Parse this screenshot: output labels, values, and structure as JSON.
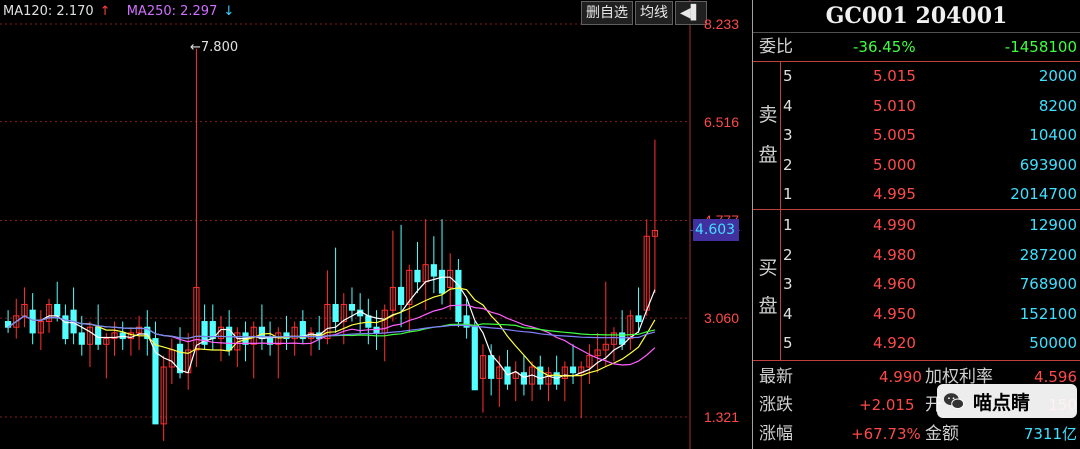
{
  "ma_legend": {
    "ma120_label": "MA120: 2.170",
    "ma120_arrow": "↑",
    "ma250_label": "MA250: 2.297",
    "ma250_arrow": "↓"
  },
  "toolbar": {
    "delete_label": "删自选",
    "avgline_label": "均线",
    "arrow_label": "◀▌"
  },
  "y_axis": [
    "8.233",
    "6.516",
    "4.777",
    "3.060",
    "1.321"
  ],
  "current_price_tag": "4.603",
  "peak_label": "7.800",
  "quote": {
    "title": "GC001 204001",
    "weibi_label": "委比",
    "weibi_pct": "-36.45%",
    "weibi_diff": "-1458100",
    "sell_label": [
      "卖",
      "盘"
    ],
    "buy_label": [
      "买",
      "盘"
    ],
    "sell": [
      {
        "level": "5",
        "price": "5.015",
        "volume": "2000"
      },
      {
        "level": "4",
        "price": "5.010",
        "volume": "8200"
      },
      {
        "level": "3",
        "price": "5.005",
        "volume": "10400"
      },
      {
        "level": "2",
        "price": "5.000",
        "volume": "693900"
      },
      {
        "level": "1",
        "price": "4.995",
        "volume": "2014700"
      }
    ],
    "buy": [
      {
        "level": "1",
        "price": "4.990",
        "volume": "12900"
      },
      {
        "level": "2",
        "price": "4.980",
        "volume": "287200"
      },
      {
        "level": "3",
        "price": "4.960",
        "volume": "768900"
      },
      {
        "level": "4",
        "price": "4.950",
        "volume": "152100"
      },
      {
        "level": "5",
        "price": "4.920",
        "volume": "50000"
      }
    ],
    "stats": {
      "latest_label": "最新",
      "latest": "4.990",
      "wrate_label": "加权利率",
      "wrate": "4.596",
      "change_label": "涨跌",
      "change": "+2.015",
      "open_label": "开",
      "open": "150",
      "pct_label": "涨幅",
      "pct": "+67.73%",
      "amount_label": "金额",
      "amount": "7311亿"
    }
  },
  "watermark": {
    "text": "喵点睛",
    "icon": "wechat-icon"
  },
  "chart_data": {
    "type": "candlestick",
    "ylim": [
      0.9,
      8.7
    ],
    "y_ticks": [
      8.233,
      6.516,
      4.777,
      3.06,
      1.321
    ],
    "current_price": 4.603,
    "peak": 7.8,
    "candles": [
      [
        3.0,
        3.2,
        2.8,
        2.9
      ],
      [
        2.9,
        3.4,
        2.7,
        3.1
      ],
      [
        3.1,
        3.6,
        2.9,
        3.3
      ],
      [
        3.2,
        3.5,
        2.6,
        2.8
      ],
      [
        2.8,
        3.2,
        2.5,
        3.0
      ],
      [
        3.0,
        3.4,
        2.8,
        3.3
      ],
      [
        3.3,
        3.7,
        3.0,
        3.1
      ],
      [
        3.1,
        3.3,
        2.6,
        2.7
      ],
      [
        3.2,
        3.6,
        2.6,
        2.8
      ],
      [
        2.8,
        3.1,
        2.4,
        2.6
      ],
      [
        2.6,
        3.0,
        2.2,
        2.9
      ],
      [
        2.9,
        3.3,
        2.5,
        2.6
      ],
      [
        2.6,
        2.8,
        2.0,
        2.7
      ],
      [
        2.7,
        3.0,
        2.4,
        2.8
      ],
      [
        2.8,
        3.0,
        2.5,
        2.7
      ],
      [
        2.7,
        2.9,
        2.4,
        2.8
      ],
      [
        2.8,
        3.1,
        2.5,
        2.9
      ],
      [
        2.9,
        3.2,
        2.4,
        2.7
      ],
      [
        2.7,
        3.0,
        1.2,
        1.2
      ],
      [
        1.2,
        2.4,
        0.9,
        2.2
      ],
      [
        2.2,
        2.7,
        1.9,
        2.5
      ],
      [
        2.6,
        2.9,
        2.0,
        2.1
      ],
      [
        2.1,
        2.8,
        1.8,
        2.5
      ],
      [
        2.5,
        7.8,
        2.2,
        3.6
      ],
      [
        3.0,
        3.3,
        2.5,
        2.6
      ],
      [
        3.0,
        3.3,
        2.5,
        2.7
      ],
      [
        2.7,
        3.1,
        2.3,
        2.9
      ],
      [
        2.9,
        3.2,
        2.4,
        2.5
      ],
      [
        2.5,
        2.9,
        2.2,
        2.8
      ],
      [
        2.8,
        3.0,
        2.3,
        2.6
      ],
      [
        2.6,
        3.0,
        2.0,
        2.9
      ],
      [
        2.9,
        3.3,
        2.5,
        2.7
      ],
      [
        2.7,
        3.0,
        2.4,
        2.6
      ],
      [
        2.6,
        2.9,
        2.0,
        2.8
      ],
      [
        2.8,
        3.1,
        2.5,
        2.7
      ],
      [
        2.7,
        3.0,
        2.4,
        2.9
      ],
      [
        3.0,
        3.2,
        2.6,
        2.7
      ],
      [
        2.7,
        2.9,
        2.4,
        2.8
      ],
      [
        2.8,
        3.1,
        2.5,
        2.7
      ],
      [
        2.7,
        3.9,
        2.6,
        3.3
      ],
      [
        3.3,
        4.3,
        2.8,
        3.0
      ],
      [
        3.0,
        3.5,
        2.6,
        3.3
      ],
      [
        3.3,
        3.6,
        3.0,
        3.2
      ],
      [
        3.2,
        3.5,
        2.8,
        3.1
      ],
      [
        3.1,
        3.4,
        2.6,
        2.9
      ],
      [
        2.9,
        3.2,
        2.5,
        2.8
      ],
      [
        2.8,
        3.3,
        2.3,
        3.2
      ],
      [
        3.2,
        4.6,
        3.0,
        3.6
      ],
      [
        3.6,
        4.7,
        2.9,
        3.3
      ],
      [
        3.3,
        4.0,
        2.8,
        3.9
      ],
      [
        3.9,
        4.4,
        3.5,
        3.7
      ],
      [
        3.7,
        4.8,
        3.2,
        4.0
      ],
      [
        4.0,
        4.5,
        3.5,
        3.8
      ],
      [
        3.9,
        4.8,
        3.3,
        3.5
      ],
      [
        3.6,
        4.2,
        3.2,
        3.9
      ],
      [
        3.9,
        4.1,
        2.9,
        3.0
      ],
      [
        3.1,
        3.4,
        2.7,
        2.9
      ],
      [
        2.9,
        3.0,
        1.8,
        1.8
      ],
      [
        2.0,
        2.6,
        1.4,
        2.4
      ],
      [
        2.4,
        2.6,
        1.7,
        2.0
      ],
      [
        2.0,
        2.4,
        1.5,
        2.2
      ],
      [
        2.2,
        2.5,
        1.8,
        1.9
      ],
      [
        2.0,
        2.3,
        1.6,
        2.1
      ],
      [
        2.1,
        2.4,
        1.7,
        1.9
      ],
      [
        1.9,
        2.3,
        1.6,
        2.2
      ],
      [
        2.2,
        2.4,
        1.8,
        1.9
      ],
      [
        1.9,
        2.2,
        1.6,
        2.1
      ],
      [
        2.1,
        2.4,
        1.8,
        1.9
      ],
      [
        2.0,
        2.3,
        1.6,
        2.2
      ],
      [
        2.2,
        2.6,
        1.9,
        2.1
      ],
      [
        2.1,
        2.3,
        1.3,
        2.2
      ],
      [
        2.2,
        2.6,
        1.9,
        2.4
      ],
      [
        2.4,
        2.8,
        2.1,
        2.5
      ],
      [
        2.5,
        3.7,
        2.2,
        2.6
      ],
      [
        2.6,
        2.9,
        2.3,
        2.8
      ],
      [
        2.8,
        3.2,
        2.5,
        2.6
      ],
      [
        2.7,
        3.2,
        2.5,
        3.1
      ],
      [
        3.1,
        3.6,
        2.8,
        3.0
      ],
      [
        3.2,
        4.8,
        3.1,
        4.5
      ],
      [
        4.5,
        6.2,
        3.5,
        4.6
      ]
    ]
  }
}
